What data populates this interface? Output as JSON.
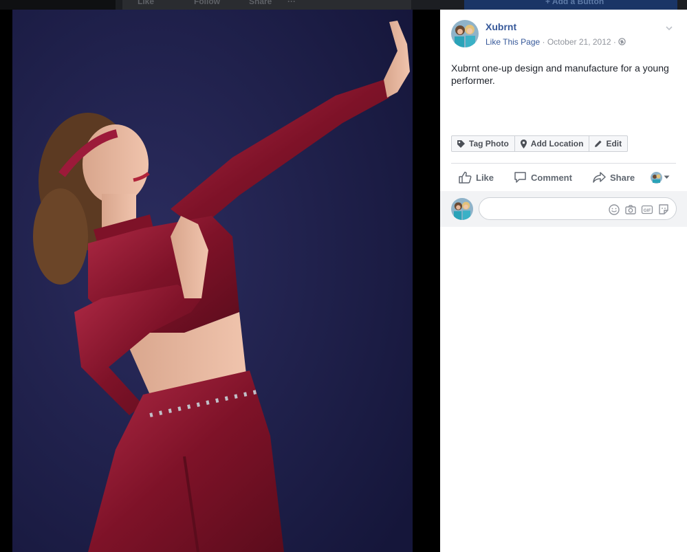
{
  "background_page": {
    "actions": [
      "Like",
      "Follow",
      "Share",
      "···"
    ],
    "add_button_label": "+ Add a Button"
  },
  "post": {
    "page_name": "Xubrnt",
    "like_page_label": "Like This Page",
    "separator": " · ",
    "date": "October 21, 2012",
    "audience_icon": "globe-icon",
    "text": "Xubrnt one-up design and manufacture for a young performer."
  },
  "photo_tools": [
    {
      "icon": "tag-icon",
      "label": "Tag Photo"
    },
    {
      "icon": "location-pin-icon",
      "label": "Add Location"
    },
    {
      "icon": "pencil-icon",
      "label": "Edit"
    }
  ],
  "actions": {
    "like": "Like",
    "comment": "Comment",
    "share": "Share"
  },
  "comment_box": {
    "placeholder": "",
    "icons": [
      "emoji-icon",
      "camera-icon",
      "gif-icon",
      "sticker-icon"
    ]
  },
  "colors": {
    "link": "#365899",
    "meta": "#90949c",
    "photo_background": "#1e1f4a",
    "costume": "#8e1730"
  }
}
